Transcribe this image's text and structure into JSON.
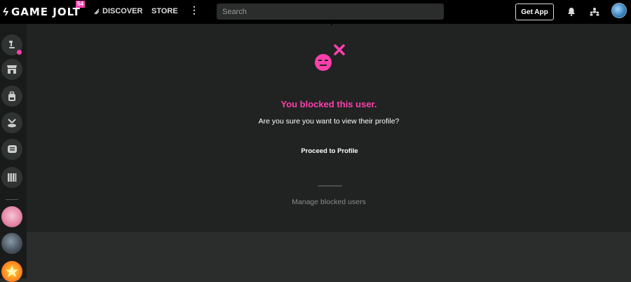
{
  "header": {
    "logo_text": "GAME JOLT",
    "logo_badge": "54",
    "discover_label": "DISCOVER",
    "store_label": "STORE",
    "more_icon": "kebab-icon",
    "search_placeholder": "Search",
    "get_app_label": "Get App",
    "icons": [
      "bell-icon",
      "friends-icon",
      "user-avatar"
    ]
  },
  "sidebar": {
    "items": [
      {
        "name": "activity",
        "icon": "activity-icon",
        "has_notification": true
      },
      {
        "name": "store",
        "icon": "storefront-icon"
      },
      {
        "name": "backpack",
        "icon": "backpack-icon"
      },
      {
        "name": "quests",
        "icon": "quest-icon"
      },
      {
        "name": "chat",
        "icon": "chat-icon"
      },
      {
        "name": "library",
        "icon": "library-icon"
      }
    ],
    "avatars": [
      "community-avatar-1",
      "community-avatar-2",
      "community-avatar-3"
    ]
  },
  "blocked": {
    "title": "You blocked this user.",
    "message": "Are you sure you want to view their profile?",
    "proceed_label": "Proceed to Profile",
    "manage_label": "Manage blocked users"
  },
  "colors": {
    "accent": "#ff3fac",
    "topbar": "#000000",
    "sidebar": "#191b1a",
    "main_bg": "#202322",
    "page_bg": "#2a2d2c"
  }
}
